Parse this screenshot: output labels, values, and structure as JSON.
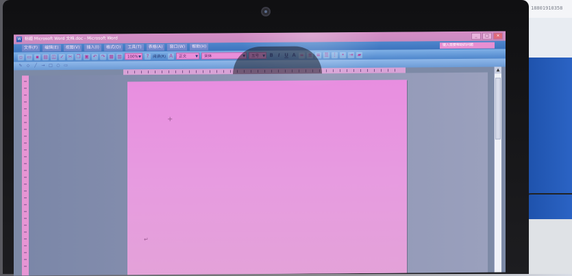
{
  "environment": {
    "sticky_note_text": "18801910358"
  },
  "window": {
    "title": "标题 Microsoft Word 文档.doc - Microsoft Word",
    "controls": [
      "_",
      "□",
      "×"
    ]
  },
  "menubar": {
    "items": [
      "文件(F)",
      "编辑(E)",
      "视图(V)",
      "插入(I)",
      "格式(O)",
      "工具(T)",
      "表格(A)",
      "窗口(W)",
      "帮助(H)"
    ],
    "help_box": "键入需要帮助的问题"
  },
  "toolbar": {
    "zoom": "100%",
    "read_mode": "阅读(R)",
    "style": "正文",
    "font": "宋体",
    "size": "五号",
    "bold": "B",
    "italic": "I",
    "underline": "U",
    "font_color": "A"
  },
  "colors": {
    "page": "#e88ee0",
    "menubar": "#3d74be"
  }
}
